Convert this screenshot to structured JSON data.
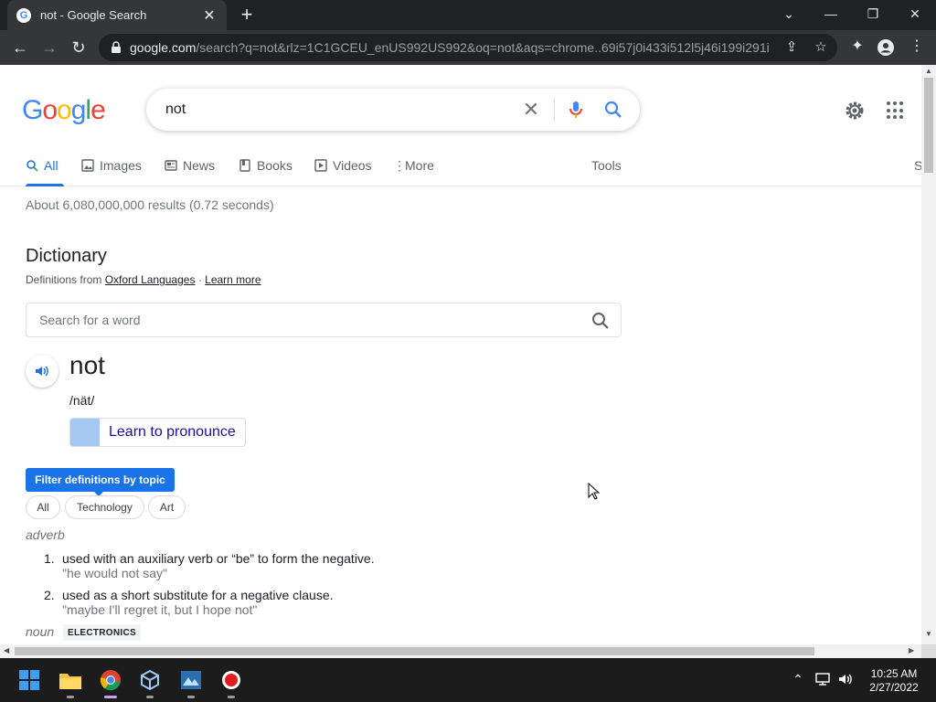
{
  "browser": {
    "tab_title": "not - Google Search",
    "url_host": "google.com",
    "url_rest": "/search?q=not&rlz=1C1GCEU_enUS992US992&oq=not&aqs=chrome..69i57j0i433i512l5j46i199i291i...",
    "new_tab": "+"
  },
  "search": {
    "query": "not",
    "logo": [
      "G",
      "o",
      "o",
      "g",
      "l",
      "e"
    ]
  },
  "tabs": {
    "all": "All",
    "images": "Images",
    "news": "News",
    "books": "Books",
    "videos": "Videos",
    "more": "More",
    "tools": "Tools",
    "cut": "S"
  },
  "results_stats": "About 6,080,000,000 results (0.72 seconds)",
  "dictionary": {
    "heading": "Dictionary",
    "source_prefix": "Definitions from",
    "source_link": "Oxford Languages",
    "separator": "·",
    "learn_more": "Learn more",
    "search_placeholder": "Search for a word",
    "word": "not",
    "phonetic": "/nät/",
    "pronounce_label": "Learn to pronounce",
    "filter_label": "Filter definitions by topic",
    "chips": [
      "All",
      "Technology",
      "Art"
    ],
    "part_of_speech": "adverb",
    "definitions": [
      {
        "num": "1.",
        "text": "used with an auxiliary verb or “be” to form the negative.",
        "example": "\"he would not say\""
      },
      {
        "num": "2.",
        "text": "used as a short substitute for a negative clause.",
        "example": "\"maybe I'll regret it, but I hope not\""
      }
    ],
    "part_of_speech_2": "noun",
    "tag_2": "ELECTRONICS"
  },
  "taskbar": {
    "time": "10:25 AM",
    "date": "2/27/2022",
    "apps": [
      "windows-start-icon",
      "file-explorer-icon",
      "chrome-icon",
      "virtualbox-icon",
      "vista-app-icon",
      "record-icon"
    ]
  },
  "colors": {
    "accent": "#1a73e8",
    "link": "#1a0dab",
    "chrome_bg": "#202124",
    "chrome_toolbar": "#35363a"
  }
}
